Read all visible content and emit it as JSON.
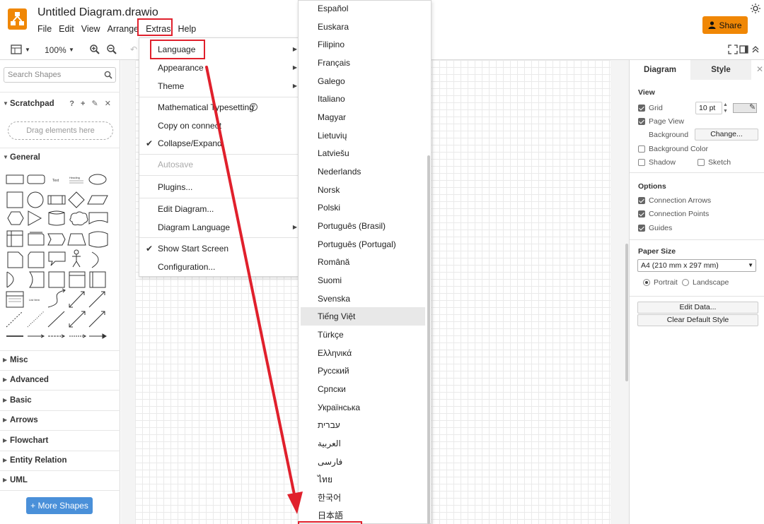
{
  "header": {
    "title": "Untitled Diagram.drawio",
    "menu": [
      "File",
      "Edit",
      "View",
      "Arrange",
      "Extras",
      "Help"
    ],
    "share_label": "Share"
  },
  "toolbar": {
    "zoom": "100%"
  },
  "left_panel": {
    "search_placeholder": "Search Shapes",
    "scratchpad": "Scratchpad",
    "scratchpad_icons": "? + ✎ ✕",
    "drag_hint": "Drag elements here",
    "general": "General",
    "sections": [
      "Misc",
      "Advanced",
      "Basic",
      "Arrows",
      "Flowchart",
      "Entity Relation",
      "UML"
    ],
    "more_shapes": "+ More Shapes"
  },
  "extras_menu": {
    "items": [
      {
        "label": "Language",
        "submenu": true
      },
      {
        "label": "Appearance",
        "submenu": true
      },
      {
        "label": "Theme",
        "submenu": true
      },
      {
        "label": "Mathematical Typesetting",
        "help": true
      },
      {
        "label": "Copy on connect"
      },
      {
        "label": "Collapse/Expand",
        "checked": true
      },
      {
        "label": "Autosave",
        "disabled": true
      },
      {
        "label": "Plugins..."
      },
      {
        "label": "Edit Diagram..."
      },
      {
        "label": "Diagram Language",
        "submenu": true
      },
      {
        "label": "Show Start Screen",
        "checked": true
      },
      {
        "label": "Configuration..."
      }
    ]
  },
  "language_menu": {
    "items": [
      "Español",
      "Euskara",
      "Filipino",
      "Français",
      "Galego",
      "Italiano",
      "Magyar",
      "Lietuvių",
      "Latviešu",
      "Nederlands",
      "Norsk",
      "Polski",
      "Português (Brasil)",
      "Português (Portugal)",
      "Română",
      "Suomi",
      "Svenska",
      "Tiếng Việt",
      "Türkçe",
      "Ελληνικά",
      "Русский",
      "Српски",
      "Українська",
      "עברית",
      "العربية",
      "فارسی",
      "ไทย",
      "한국어",
      "日本語"
    ],
    "highlighted": "Tiếng Việt"
  },
  "right_panel": {
    "tab_diagram": "Diagram",
    "tab_style": "Style",
    "view_label": "View",
    "grid": "Grid",
    "grid_size": "10 pt",
    "page_view": "Page View",
    "background": "Background",
    "change_btn": "Change...",
    "background_color": "Background Color",
    "shadow": "Shadow",
    "sketch": "Sketch",
    "options_label": "Options",
    "connection_arrows": "Connection Arrows",
    "connection_points": "Connection Points",
    "guides": "Guides",
    "paper_size_label": "Paper Size",
    "paper_size": "A4 (210 mm x 297 mm)",
    "portrait": "Portrait",
    "landscape": "Landscape",
    "edit_data": "Edit Data...",
    "clear_style": "Clear Default Style"
  },
  "colors": {
    "accent": "#f08705",
    "annotation": "#e0202c",
    "more_shapes": "#4a90d9"
  }
}
